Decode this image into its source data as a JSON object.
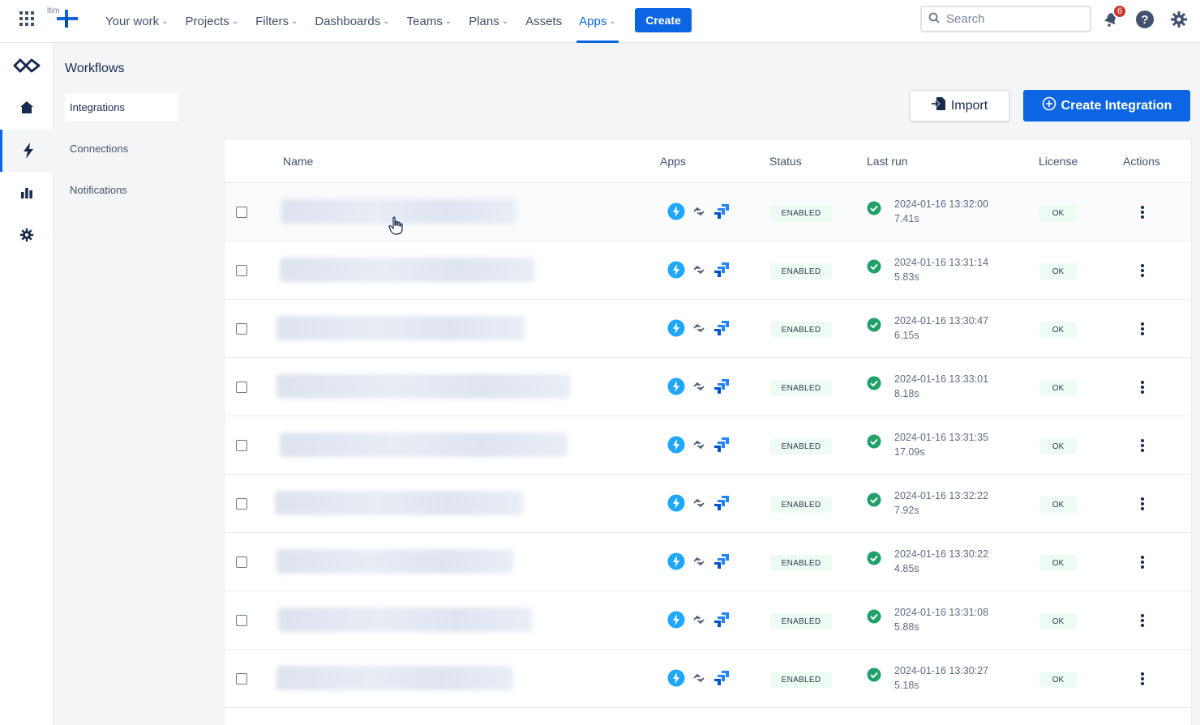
{
  "topbar": {
    "logo_text": "ltim",
    "nav": [
      {
        "label": "Your work",
        "chevron": true
      },
      {
        "label": "Projects",
        "chevron": true
      },
      {
        "label": "Filters",
        "chevron": true
      },
      {
        "label": "Dashboards",
        "chevron": true
      },
      {
        "label": "Teams",
        "chevron": true
      },
      {
        "label": "Plans",
        "chevron": true
      },
      {
        "label": "Assets",
        "chevron": false
      },
      {
        "label": "Apps",
        "chevron": true,
        "active": true
      }
    ],
    "create_label": "Create",
    "search_placeholder": "Search",
    "notifications_count": "6",
    "accent_color": "#0c66e4"
  },
  "rail": {
    "items": [
      "workflow-logo-icon",
      "home-icon",
      "bolt-icon",
      "bar-chart-icon",
      "gear-icon"
    ],
    "active_index": 2
  },
  "subnav": {
    "title": "Workflows",
    "items": [
      {
        "label": "Integrations",
        "active": true
      },
      {
        "label": "Connections",
        "active": false
      },
      {
        "label": "Notifications",
        "active": false
      }
    ]
  },
  "main": {
    "import_label": "Import",
    "create_integration_label": "Create Integration",
    "columns": {
      "name": "Name",
      "apps": "Apps",
      "status": "Status",
      "last_run": "Last run",
      "license": "License",
      "actions": "Actions"
    },
    "rows": [
      {
        "status": "ENABLED",
        "time": "2024-01-16 13:32:00",
        "duration": "7.41s",
        "license": "OK"
      },
      {
        "status": "ENABLED",
        "time": "2024-01-16 13:31:14",
        "duration": "5.83s",
        "license": "OK"
      },
      {
        "status": "ENABLED",
        "time": "2024-01-16 13:30:47",
        "duration": "6.15s",
        "license": "OK"
      },
      {
        "status": "ENABLED",
        "time": "2024-01-16 13:33:01",
        "duration": "8.18s",
        "license": "OK"
      },
      {
        "status": "ENABLED",
        "time": "2024-01-16 13:31:35",
        "duration": "17.09s",
        "license": "OK"
      },
      {
        "status": "ENABLED",
        "time": "2024-01-16 13:32:22",
        "duration": "7.92s",
        "license": "OK"
      },
      {
        "status": "ENABLED",
        "time": "2024-01-16 13:30:22",
        "duration": "4.85s",
        "license": "OK"
      },
      {
        "status": "ENABLED",
        "time": "2024-01-16 13:31:08",
        "duration": "5.88s",
        "license": "OK"
      },
      {
        "status": "ENABLED",
        "time": "2024-01-16 13:30:27",
        "duration": "5.18s",
        "license": "OK"
      }
    ],
    "app_icons": [
      "lightning-app-icon",
      "link-arrows-icon",
      "jira-icon"
    ]
  }
}
